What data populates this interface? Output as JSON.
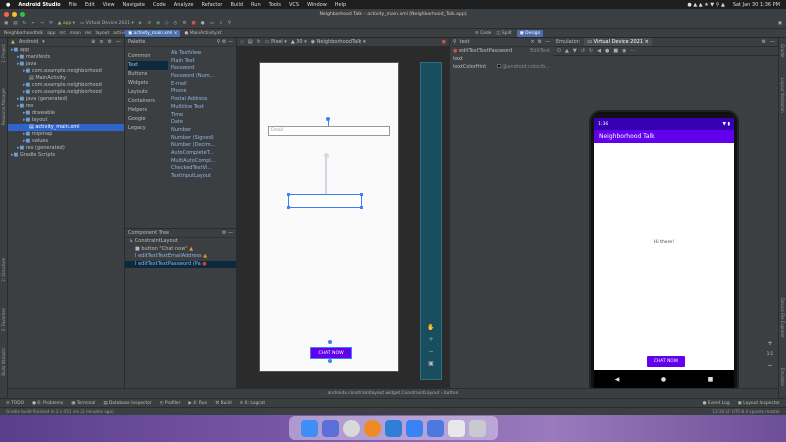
{
  "menubar": {
    "apple": "",
    "app_name": "Android Studio",
    "items": [
      "File",
      "Edit",
      "View",
      "Navigate",
      "Code",
      "Analyze",
      "Refactor",
      "Build",
      "Run",
      "Tools",
      "VCS",
      "Window",
      "Help"
    ],
    "clock": "Sat Jan 30 1:36 PM"
  },
  "window_title": "Neighborhood Talk – activity_main.xml [Neighborhood_Talk.app]",
  "toolbar": {
    "module": "app",
    "device": "Virtual Device 2021"
  },
  "navbar": {
    "crumbs": [
      "Neighborhoodtalk",
      "app",
      "src",
      "main",
      "res",
      "layout",
      "activity_main.xml"
    ],
    "tab_active": "activity_main.xml",
    "tab_other": "MainActivity.kt"
  },
  "left_tool_labels": [
    "1: Project",
    "Resource Manager",
    "2: Structure",
    "2: Favorites",
    "Build Variants"
  ],
  "project": {
    "view_label": "Android",
    "tree": [
      {
        "indent": 0,
        "text": "app",
        "kind": "folder"
      },
      {
        "indent": 1,
        "text": "manifests",
        "kind": "folder"
      },
      {
        "indent": 1,
        "text": "java",
        "kind": "folder"
      },
      {
        "indent": 2,
        "text": "com.example.neighborhood",
        "kind": "folder"
      },
      {
        "indent": 3,
        "text": "MainActivity",
        "kind": "file"
      },
      {
        "indent": 2,
        "text": "com.example.neighborhood",
        "kind": "folder"
      },
      {
        "indent": 2,
        "text": "com.example.neighborhood",
        "kind": "folder"
      },
      {
        "indent": 1,
        "text": "java (generated)",
        "kind": "folder"
      },
      {
        "indent": 1,
        "text": "res",
        "kind": "folder"
      },
      {
        "indent": 2,
        "text": "drawable",
        "kind": "folder"
      },
      {
        "indent": 2,
        "text": "layout",
        "kind": "folder"
      },
      {
        "indent": 3,
        "text": "activity_main.xml",
        "kind": "selected"
      },
      {
        "indent": 2,
        "text": "mipmap",
        "kind": "folder"
      },
      {
        "indent": 2,
        "text": "values",
        "kind": "folder"
      },
      {
        "indent": 1,
        "text": "res (generated)",
        "kind": "folder"
      },
      {
        "indent": 0,
        "text": "Gradle Scripts",
        "kind": "folder"
      }
    ]
  },
  "palette": {
    "title": "Palette",
    "categories": [
      "Common",
      "Text",
      "Buttons",
      "Widgets",
      "Layouts",
      "Containers",
      "Helpers",
      "Google",
      "Legacy"
    ],
    "selected_category": "Text",
    "items": [
      "Ab TextView",
      "Plain Text",
      "Password",
      "Password (Num...",
      "E-mail",
      "Phone",
      "Postal Address",
      "Multiline Text",
      "Time",
      "Date",
      "Number",
      "Number (Signed)",
      "Number (Decim...",
      "AutoCompleteT...",
      "MultiAutoCompl...",
      "CheckedTextVi...",
      "TextInputLayout"
    ]
  },
  "component_tree": {
    "title": "Component Tree",
    "root": "ConstraintLayout",
    "children": [
      {
        "text": "button  \"Chat now\"",
        "status": "warn"
      },
      {
        "text": "editTextTextEmailAddress",
        "status": "warn"
      },
      {
        "text": "editTextTextPassword  (Pa",
        "status": "err"
      }
    ]
  },
  "canvas_bar": {
    "device": "Pixel",
    "api": "30",
    "theme": "NeighborhoodTalk"
  },
  "design_mode": {
    "code": "Code",
    "split": "Split",
    "design": "Design"
  },
  "design_canvas": {
    "email_hint": "Email",
    "chat_button": "CHAT NOW"
  },
  "attributes": {
    "search_placeholder": "text",
    "id": "editTextTextPassword",
    "id_type": "EditText",
    "rows": [
      {
        "label": "text",
        "value": ""
      },
      {
        "label": "textColorHint",
        "value": "@android:color/b..."
      }
    ]
  },
  "emulator": {
    "label": "Emulator:",
    "device": "Virtual Device 2021",
    "status_time": "1:36",
    "app_title": "Neighborhood Talk",
    "hello": "Hi there!",
    "chat_button": "CHAT NOW"
  },
  "right_tool_labels": [
    "Gradle",
    "Layout Validation",
    "Device File Explorer",
    "Emulator"
  ],
  "breadcrumb_bottom": "androidx.constraintlayout.widget.ConstraintLayout  ›  button",
  "bottom_tabs": [
    "TODO",
    "6: Problems",
    "Terminal",
    "Database Inspector",
    "Profiler",
    "4: Run",
    "Build",
    "6: Logcat"
  ],
  "bottom_right": [
    "Event Log",
    "Layout Inspector"
  ],
  "status": {
    "message": "Gradle build finished in 2 s 451 ms (2 minutes ago)",
    "right": "12:20  LF  UTF-8  4 spaces  master"
  }
}
